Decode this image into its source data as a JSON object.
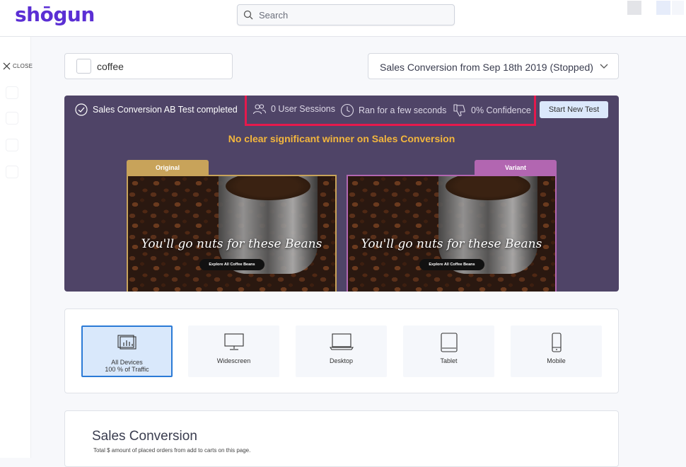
{
  "app": {
    "logo_text": "shōgun",
    "brand_color": "#5b2fd4"
  },
  "search": {
    "placeholder": "Search"
  },
  "rail": {
    "close_label": "CLOSE"
  },
  "page": {
    "name": "coffee"
  },
  "test_selector": {
    "selected": "Sales Conversion from Sep 18th 2019 (Stopped)"
  },
  "result_panel": {
    "status": "Sales Conversion AB Test completed",
    "stats": {
      "sessions": "0 User Sessions",
      "duration": "Ran for a few seconds",
      "confidence": "0% Confidence"
    },
    "start_button": "Start New Test",
    "headline": "No clear significant winner on Sales Conversion",
    "original": {
      "tab_label": "Original",
      "tagline": "You'll go nuts for these Beans",
      "button": "Explore All Coffee Beans"
    },
    "variant": {
      "tab_label": "Variant",
      "tagline": "You'll go nuts for these Beans",
      "button": "Explore All Coffee Beans"
    }
  },
  "devices": [
    {
      "label": "All Devices",
      "sub": "100 % of Traffic",
      "icon": "all-devices-icon",
      "active": true
    },
    {
      "label": "Widescreen",
      "icon": "widescreen-icon"
    },
    {
      "label": "Desktop",
      "icon": "laptop-icon"
    },
    {
      "label": "Tablet",
      "icon": "tablet-icon"
    },
    {
      "label": "Mobile",
      "icon": "mobile-icon"
    }
  ],
  "metric": {
    "title": "Sales Conversion",
    "description": "Total $ amount of placed orders from add to carts on this page."
  },
  "colors": {
    "panel_bg": "#4f4467",
    "highlight_red": "#e5194c",
    "headline_gold": "#f3b63d",
    "original_gold": "#c8a35a",
    "variant_purple": "#b266b1",
    "active_blue": "#2b7ad6"
  }
}
